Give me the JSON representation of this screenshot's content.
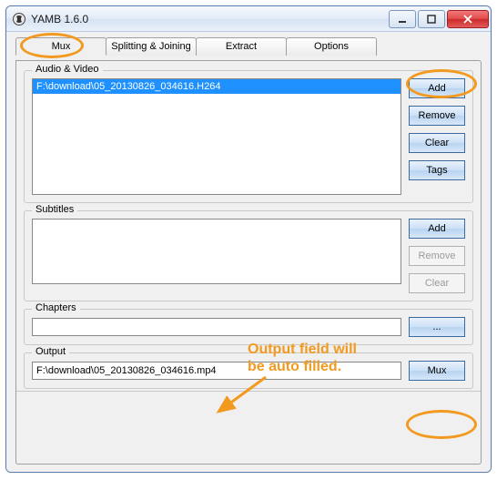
{
  "window": {
    "title": "YAMB 1.6.0"
  },
  "tabs": {
    "mux": "Mux",
    "split": "Splitting & Joining",
    "extract": "Extract",
    "options": "Options"
  },
  "groups": {
    "av": "Audio & Video",
    "subtitles": "Subtitles",
    "chapters": "Chapters",
    "output": "Output"
  },
  "buttons": {
    "add": "Add",
    "remove": "Remove",
    "clear": "Clear",
    "tags": "Tags",
    "browse": "...",
    "mux": "Mux"
  },
  "av_items": [
    "F:\\download\\05_20130826_034616.H264"
  ],
  "chapters_value": "",
  "output_value": "F:\\download\\05_20130826_034616.mp4",
  "annotation": {
    "line1": "Output field will",
    "line2": "be auto filled."
  },
  "colors": {
    "highlight": "#f29a1f",
    "selection": "#1e90ff"
  }
}
